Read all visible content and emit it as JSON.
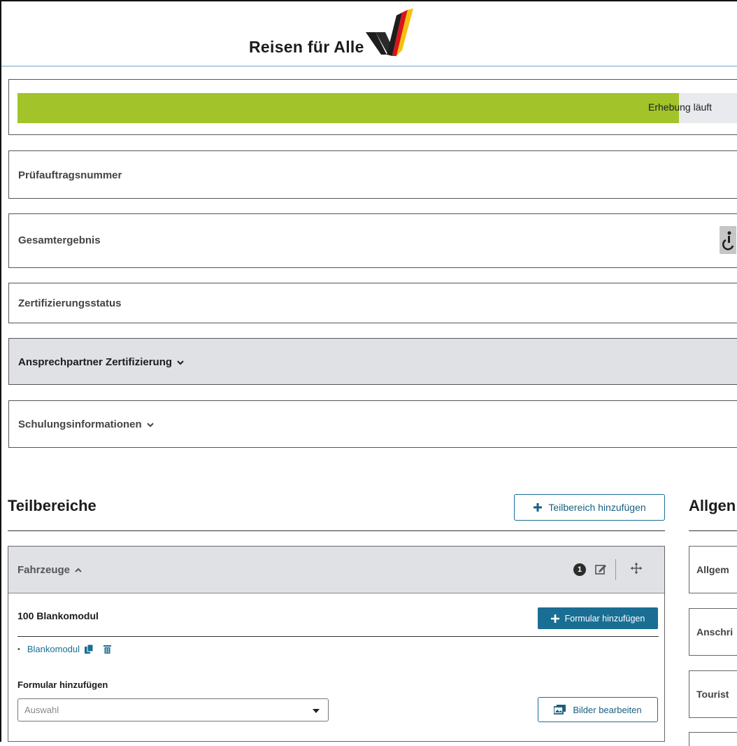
{
  "header": {
    "brand_text": "Reisen für Alle"
  },
  "progress": {
    "status_text": "Erhebung läuft",
    "fill_fraction": 0.91,
    "fill_color": "#a2c42a"
  },
  "fields": {
    "pruefauftrag": "Prüfauftragsnummer",
    "gesamtergebnis": "Gesamtergebnis",
    "zertifizierungsstatus": "Zertifizierungsstatus",
    "ansprechpartner": "Ansprechpartner Zertifizierung",
    "schulungsinformationen": "Schulungsinformationen"
  },
  "teilbereiche": {
    "title": "Teilbereiche",
    "add_button": "Teilbereich hinzufügen",
    "section": {
      "title": "Fahrzeuge",
      "badge_count": "1",
      "module_title": "100 Blankomodul",
      "add_form_button": "Formular hinzufügen",
      "items": [
        "Blankomodul"
      ],
      "form_label": "Formular hinzufügen",
      "select_placeholder": "Auswahl",
      "images_button": "Bilder bearbeiten"
    }
  },
  "allgemein": {
    "title": "Allgen",
    "cards": [
      "Allgem",
      "Anschri",
      "Tourist"
    ]
  },
  "colors": {
    "accent": "#1a6e93",
    "progress": "#a2c42a",
    "section_bg": "#dfe1e5"
  }
}
